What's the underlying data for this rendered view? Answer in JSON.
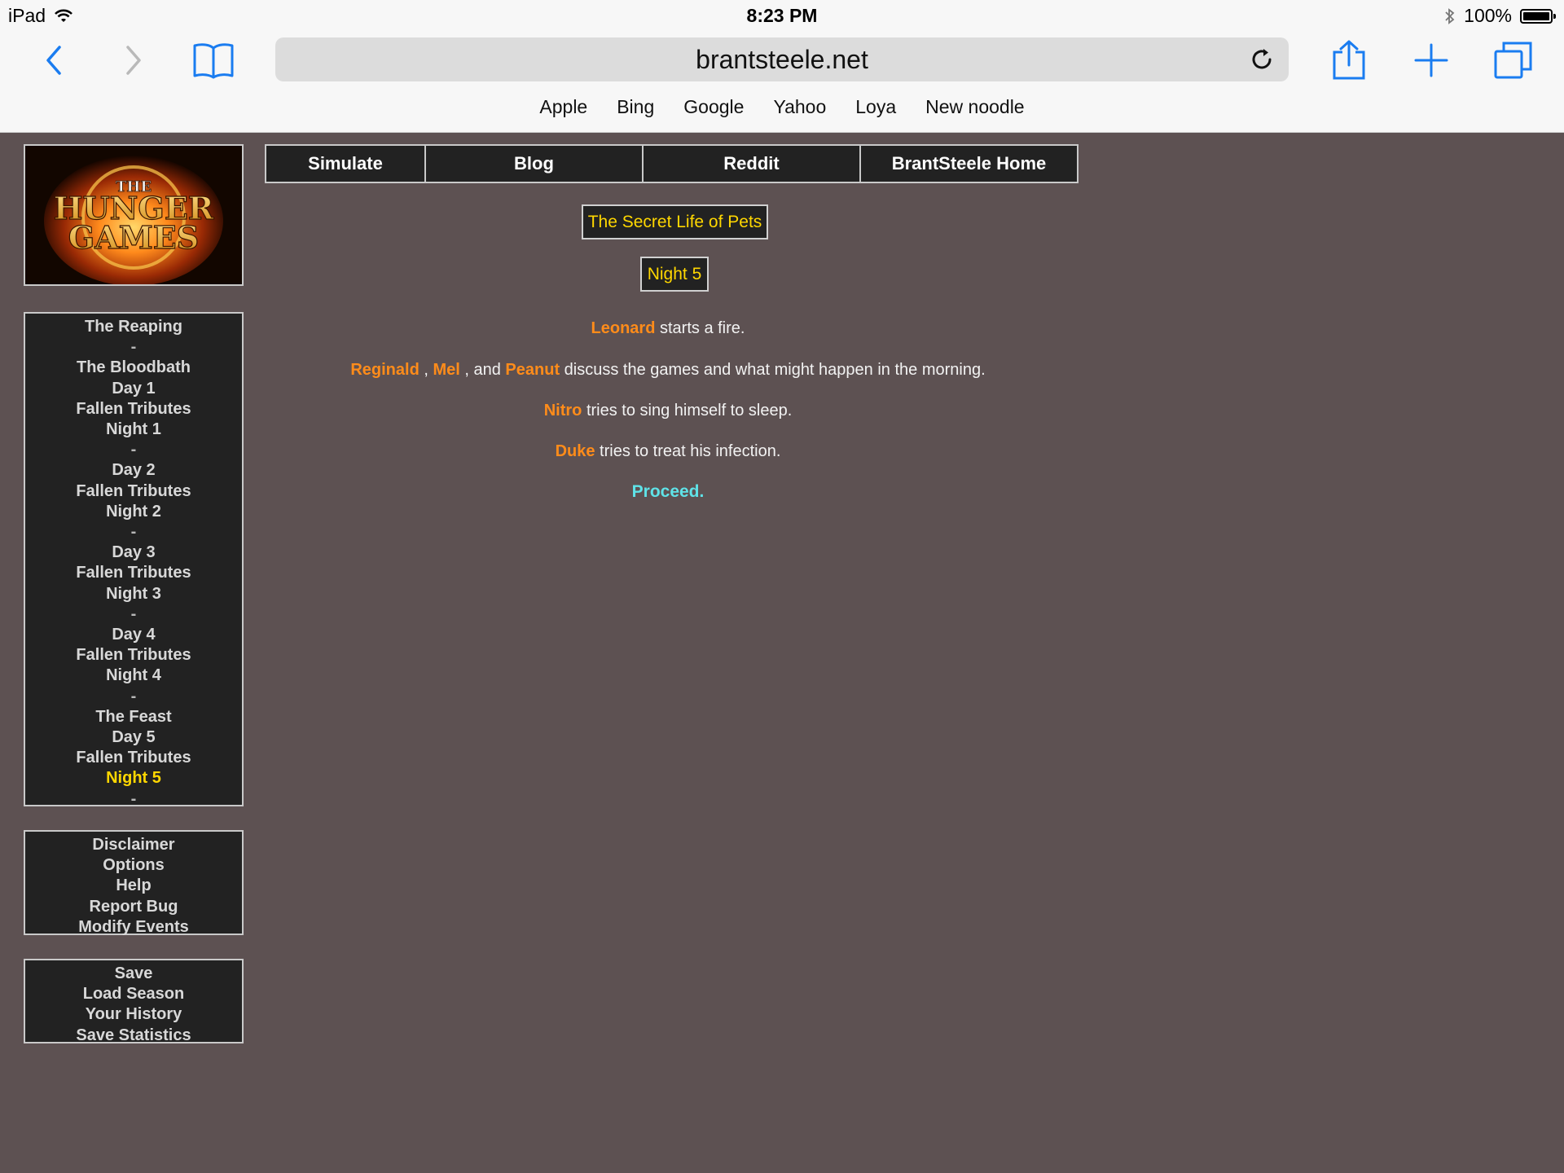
{
  "status_bar": {
    "device": "iPad",
    "time": "8:23 PM",
    "battery": "100%"
  },
  "browser": {
    "url": "brantsteele.net",
    "favorites": [
      "Apple",
      "Bing",
      "Google",
      "Yahoo",
      "Loya",
      "New noodle"
    ]
  },
  "logo": {
    "line1": "THE",
    "line2": "HUNGER",
    "line3": "GAMES"
  },
  "top_nav": [
    "Simulate",
    "Blog",
    "Reddit",
    "BrantSteele Home"
  ],
  "season_title": "The Secret Life of Pets",
  "phase_title": "Night 5",
  "events": [
    {
      "parts": [
        {
          "t": "Leonard",
          "trib": true
        },
        {
          "t": " starts a fire."
        }
      ]
    },
    {
      "parts": [
        {
          "t": "Reginald",
          "trib": true
        },
        {
          "t": " , "
        },
        {
          "t": "Mel",
          "trib": true
        },
        {
          "t": " , and "
        },
        {
          "t": "Peanut",
          "trib": true
        },
        {
          "t": " discuss the games and what might happen in the morning."
        }
      ]
    },
    {
      "parts": [
        {
          "t": "Nitro",
          "trib": true
        },
        {
          "t": " tries to sing himself to sleep."
        }
      ]
    },
    {
      "parts": [
        {
          "t": "Duke",
          "trib": true
        },
        {
          "t": " tries to treat his infection."
        }
      ]
    }
  ],
  "proceed": "Proceed.",
  "sidebar_progress": [
    "The Reaping",
    "-",
    "The Bloodbath",
    "Day 1",
    "Fallen Tributes",
    "Night 1",
    "-",
    "Day 2",
    "Fallen Tributes",
    "Night 2",
    "-",
    "Day 3",
    "Fallen Tributes",
    "Night 3",
    "-",
    "Day 4",
    "Fallen Tributes",
    "Night 4",
    "-",
    "The Feast",
    "Day 5",
    "Fallen Tributes",
    "Night 5",
    "-"
  ],
  "sidebar_active": "Night 5",
  "sidebar_info": [
    "Disclaimer",
    "Options",
    "Help",
    "Report Bug",
    "Modify Events"
  ],
  "sidebar_save": [
    "Save",
    "Load Season",
    "Your History",
    "Save Statistics"
  ],
  "colors": {
    "tribute": "#ff8c1a",
    "title": "#ffd700",
    "proceed": "#5fe3e8",
    "background": "#5d5152",
    "ios_blue": "#1a7cf0"
  }
}
